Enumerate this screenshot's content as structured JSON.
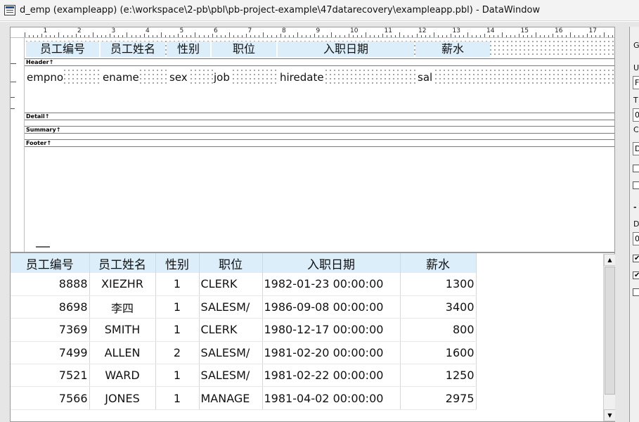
{
  "window": {
    "title": "d_emp  (exampleapp) (e:\\workspace\\2-pb\\pbl\\pb-project-example\\47datarecovery\\exampleapp.pbl) - DataWindow"
  },
  "ruler": {
    "numbers": [
      "1",
      "2",
      "3",
      "4",
      "5",
      "6",
      "7",
      "8",
      "9",
      "10",
      "11",
      "12",
      "13",
      "14",
      "15",
      "16",
      "17"
    ]
  },
  "bands": {
    "header": "Header↑",
    "detail": "Detail↑",
    "summary": "Summary↑",
    "footer": "Footer↑"
  },
  "design": {
    "headers": [
      "员工编号",
      "员工姓名",
      "性别",
      "职位",
      "入职日期",
      "薪水"
    ],
    "fields": [
      "empno",
      "ename",
      "sex",
      "job",
      "hiredate",
      "sal"
    ]
  },
  "preview": {
    "columns": [
      "员工编号",
      "员工姓名",
      "性别",
      "职位",
      "入职日期",
      "薪水"
    ],
    "rows": [
      [
        "8888",
        "XIEZHR",
        "1",
        "CLERK",
        "1982-01-23 00:00:00",
        "1300"
      ],
      [
        "8698",
        "李四",
        "1",
        "SALESM/",
        "1986-09-08 00:00:00",
        "3400"
      ],
      [
        "7369",
        "SMITH",
        "1",
        "CLERK",
        "1980-12-17 00:00:00",
        "800"
      ],
      [
        "7499",
        "ALLEN",
        "2",
        "SALESM/",
        "1981-02-20 00:00:00",
        "1600"
      ],
      [
        "7521",
        "WARD",
        "1",
        "SALESM/",
        "1981-02-22 00:00:00",
        "1250"
      ],
      [
        "7566",
        "JONES",
        "1",
        "MANAGE",
        "1981-04-02 00:00:00",
        "2975"
      ]
    ]
  },
  "props": {
    "labels": [
      "G",
      "U",
      "T",
      "C",
      "D"
    ],
    "fields": [
      "F",
      "0",
      "D",
      "0"
    ],
    "checks": [
      false,
      false,
      true,
      true,
      false
    ],
    "section": "-"
  },
  "colors": {
    "header_fill": "#dbeefa",
    "panel": "#e6e6e6"
  }
}
